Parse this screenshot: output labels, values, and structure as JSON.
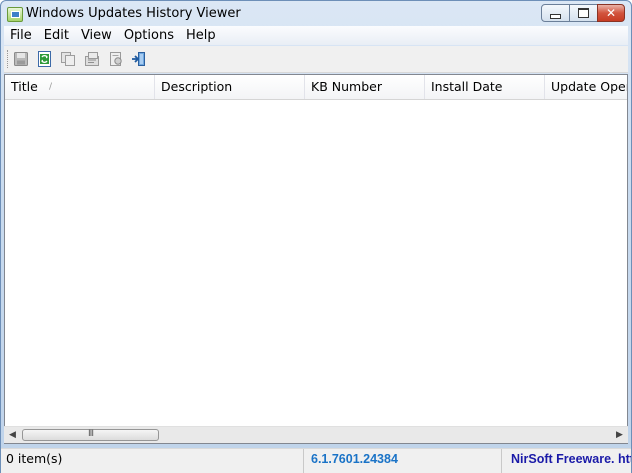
{
  "window": {
    "title": "Windows Updates History Viewer"
  },
  "caption_buttons": {
    "minimize": "minimize",
    "maximize": "maximize",
    "close": "✕"
  },
  "menu": [
    "File",
    "Edit",
    "View",
    "Options",
    "Help"
  ],
  "toolbar": {
    "buttons": [
      {
        "icon": "save-icon",
        "enabled": false
      },
      {
        "icon": "refresh-icon",
        "enabled": true
      },
      {
        "icon": "copy-icon",
        "enabled": false
      },
      {
        "icon": "properties-icon",
        "enabled": false
      },
      {
        "icon": "html-report-icon",
        "enabled": false
      },
      {
        "icon": "exit-icon",
        "enabled": true
      }
    ]
  },
  "list": {
    "columns": [
      "Title",
      "Description",
      "KB Number",
      "Install Date",
      "Update Operation"
    ],
    "sort_indicator": "/",
    "rows": []
  },
  "scrollbar": {
    "grip": "III"
  },
  "status": {
    "count": "0 item(s)",
    "version": "6.1.7601.24384",
    "credit": "NirSoft Freeware. http://www.nirsoft.net"
  },
  "colors": {
    "version_text": "#1a73c7",
    "credit_text": "#1a1aa8",
    "close_button": "#c73b23"
  }
}
